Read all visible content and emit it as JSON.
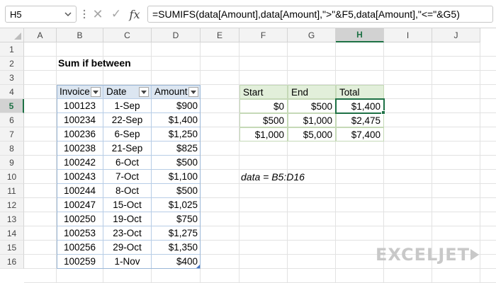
{
  "formula_bar": {
    "name_box": "H5",
    "cancel_icon": "x-icon",
    "enter_icon": "check-icon",
    "function_icon": "fx-icon",
    "function_glyph": "fx",
    "formula": "=SUMIFS(data[Amount],data[Amount],\">\"&F5,data[Amount],\"<=\"&G5)"
  },
  "sheet": {
    "columns": [
      "A",
      "B",
      "C",
      "D",
      "E",
      "F",
      "G",
      "H",
      "I",
      "J"
    ],
    "selected_column": "H",
    "rows": [
      "1",
      "2",
      "3",
      "4",
      "5",
      "6",
      "7",
      "8",
      "9",
      "10",
      "11",
      "12",
      "13",
      "14",
      "15",
      "16"
    ],
    "selected_row": "5",
    "title": "Sum if between",
    "note": "data = B5:D16"
  },
  "data_table": {
    "headers": [
      "Invoice",
      "Date",
      "Amount"
    ],
    "rows": [
      [
        "100123",
        "1-Sep",
        "$900"
      ],
      [
        "100234",
        "22-Sep",
        "$1,400"
      ],
      [
        "100236",
        "6-Sep",
        "$1,250"
      ],
      [
        "100238",
        "21-Sep",
        "$825"
      ],
      [
        "100242",
        "6-Oct",
        "$500"
      ],
      [
        "100243",
        "7-Oct",
        "$1,100"
      ],
      [
        "100244",
        "8-Oct",
        "$500"
      ],
      [
        "100247",
        "15-Oct",
        "$1,025"
      ],
      [
        "100250",
        "19-Oct",
        "$750"
      ],
      [
        "100253",
        "23-Oct",
        "$1,275"
      ],
      [
        "100256",
        "29-Oct",
        "$1,350"
      ],
      [
        "100259",
        "1-Nov",
        "$400"
      ]
    ]
  },
  "summary_table": {
    "headers": [
      "Start",
      "End",
      "Total"
    ],
    "rows": [
      [
        "$0",
        "$500",
        "$1,400"
      ],
      [
        "$500",
        "$1,000",
        "$2,475"
      ],
      [
        "$1,000",
        "$5,000",
        "$7,400"
      ]
    ]
  },
  "branding": {
    "logo_text": "EXCELJET"
  },
  "colors": {
    "accent_green": "#1e7145",
    "table_header_blue": "#dce6f1",
    "summary_header_green": "#e2efda"
  }
}
